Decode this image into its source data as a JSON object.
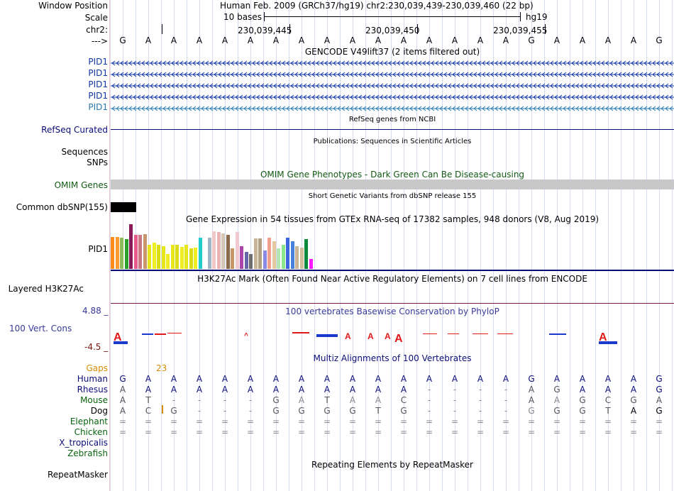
{
  "header": {
    "window_position_label": "Window Position",
    "scale_label": "Scale",
    "chrom_label": "chr2:",
    "strand_label": "--->",
    "assembly": "Human Feb. 2009 (GRCh37/hg19)   chr2:230,039,439-230,039,460 (22 bp)",
    "scale_text": "10 bases",
    "scale_db": "hg19",
    "positions": [
      "230,039,445",
      "230,039,450",
      "230,039,455"
    ]
  },
  "sequence": [
    "G",
    "A",
    "A",
    "A",
    "A",
    "A",
    "A",
    "A",
    "A",
    "A",
    "A",
    "A",
    "A",
    "A",
    "A",
    "A",
    "G",
    "A",
    "A",
    "A",
    "A",
    "G"
  ],
  "tracks": {
    "gencode_title": "GENCODE V49lift37 (2 items filtered out)",
    "gencode_items": [
      "PID1",
      "PID1",
      "PID1",
      "PID1",
      "PID1"
    ],
    "refseq_title": "RefSeq genes from NCBI",
    "refseq_label": "RefSeq Curated",
    "publications_title": "Publications: Sequences in Scientific Articles",
    "sequences_label": "Sequences",
    "snps_label": "SNPs",
    "omim_title": "OMIM Gene Phenotypes - Dark Green Can Be Disease-causing",
    "omim_label": "OMIM Genes",
    "dbsnp_title": "Short Genetic Variants from dbSNP release 155",
    "dbsnp_label": "Common dbSNP(155)",
    "gtex_title": "Gene Expression in 54 tissues from GTEx RNA-seq of 17382 samples, 948 donors (V8, Aug 2019)",
    "gtex_label": "PID1",
    "h3k27_title": "H3K27Ac Mark (Often Found Near Active Regulatory Elements) on 7 cell lines from ENCODE",
    "h3k27_label": "Layered H3K27Ac",
    "phylop_title": "100 vertebrates Basewise Conservation by PhyloP",
    "phylop_label": "100 Vert. Cons",
    "phylop_max": "4.88 _",
    "phylop_min": "-4.5 _",
    "multiz_title": "Multiz Alignments of 100 Vertebrates",
    "gaps_label": "Gaps",
    "gaps_value": "23",
    "repeat_title": "Repeating Elements by RepeatMasker",
    "repeat_label": "RepeatMasker"
  },
  "alignment": {
    "species": [
      "Human",
      "Rhesus",
      "Mouse",
      "Dog",
      "Elephant",
      "Chicken",
      "X_tropicalis",
      "Zebrafish"
    ],
    "rows": {
      "Human": [
        "G",
        "A",
        "A",
        "A",
        "A",
        "A",
        "A",
        "A",
        "A",
        "A",
        "A",
        "A",
        "A",
        "A",
        "A",
        "A",
        "G",
        "A",
        "A",
        "A",
        "A",
        "G"
      ],
      "Rhesus": [
        "A",
        "A",
        "A",
        "A",
        "A",
        "A",
        "A",
        "A",
        "A",
        "A",
        "A",
        "A",
        "-",
        "-",
        "-",
        "-",
        "A",
        "G",
        "A",
        "A",
        "A",
        "G"
      ],
      "Mouse": [
        "A",
        "T",
        "-",
        "-",
        "-",
        "-",
        "G",
        "A",
        "T",
        "A",
        "A",
        "C",
        "-",
        "-",
        "-",
        "-",
        "A",
        "A",
        "G",
        "C",
        "G",
        "A"
      ],
      "Dog": [
        "A",
        "C",
        "G",
        "-",
        "-",
        "-",
        "G",
        "G",
        "G",
        "G",
        "T",
        "G",
        "-",
        "-",
        "-",
        "-",
        "G",
        "G",
        "G",
        "T",
        "A",
        "G"
      ],
      "Elephant": [
        "=",
        "=",
        "=",
        "=",
        "=",
        "=",
        "=",
        "=",
        "=",
        "=",
        "=",
        "=",
        "=",
        "=",
        "=",
        "=",
        "=",
        "=",
        "=",
        "=",
        "=",
        "="
      ],
      "Chicken": [
        "=",
        "=",
        "=",
        "=",
        "=",
        "=",
        "=",
        "=",
        "=",
        "=",
        "=",
        "=",
        "=",
        "=",
        "=",
        "=",
        "=",
        "=",
        "=",
        "=",
        "=",
        "="
      ]
    }
  },
  "gtex_bars": [
    {
      "value": 0.95,
      "color": "#ff8c1a"
    },
    {
      "value": 0.95,
      "color": "#ff9b2e"
    },
    {
      "value": 0.92,
      "color": "#8fbc5a"
    },
    {
      "value": 0.88,
      "color": "#2ba02b"
    },
    {
      "value": 1.32,
      "color": "#8a1a5a"
    },
    {
      "value": 1.0,
      "color": "#e65a8c"
    },
    {
      "value": 1.0,
      "color": "#c87882"
    },
    {
      "value": 1.02,
      "color": "#c8966e"
    },
    {
      "value": 0.72,
      "color": "#e6e61a"
    },
    {
      "value": 0.78,
      "color": "#eeee22"
    },
    {
      "value": 0.72,
      "color": "#dcdc14"
    },
    {
      "value": 0.66,
      "color": "#e6e61a"
    },
    {
      "value": 0.45,
      "color": "#eeee22"
    },
    {
      "value": 0.72,
      "color": "#e6e61a"
    },
    {
      "value": 0.72,
      "color": "#dcdc14"
    },
    {
      "value": 0.65,
      "color": "#eeee22"
    },
    {
      "value": 0.72,
      "color": "#e6e61a"
    },
    {
      "value": 0.6,
      "color": "#dcdc14"
    },
    {
      "value": 0.62,
      "color": "#eeee22"
    },
    {
      "value": 0.92,
      "color": "#22cccc"
    },
    {
      "value": 0.0,
      "color": "#ffffff"
    },
    {
      "value": 0.92,
      "color": "#a0b4c8"
    },
    {
      "value": 1.1,
      "color": "#f0c8c8"
    },
    {
      "value": 1.08,
      "color": "#e8b4b4"
    },
    {
      "value": 1.04,
      "color": "#d4c8b4"
    },
    {
      "value": 1.0,
      "color": "#8a6a4a"
    },
    {
      "value": 0.6,
      "color": "#c89664"
    },
    {
      "value": 1.08,
      "color": "#f0c8d0"
    },
    {
      "value": 0.66,
      "color": "#aa44aa"
    },
    {
      "value": 0.5,
      "color": "#6666aa"
    },
    {
      "value": 0.45,
      "color": "#6e6e6e"
    },
    {
      "value": 0.91,
      "color": "#c8b496"
    },
    {
      "value": 0.91,
      "color": "#b4a082"
    },
    {
      "value": 0.55,
      "color": "#8a8ae6"
    },
    {
      "value": 0.92,
      "color": "#f0a08c"
    },
    {
      "value": 0.82,
      "color": "#e6c8a0"
    },
    {
      "value": 0.6,
      "color": "#b4e6b4"
    },
    {
      "value": 0.72,
      "color": "#8ce68c"
    },
    {
      "value": 0.92,
      "color": "#3c64dc"
    },
    {
      "value": 0.82,
      "color": "#4682dc"
    },
    {
      "value": 0.68,
      "color": "#c8b496"
    },
    {
      "value": 0.62,
      "color": "#d2be9b"
    },
    {
      "value": 0.88,
      "color": "#0a8a3c"
    },
    {
      "value": 0.3,
      "color": "#ff1aff"
    }
  ],
  "colors": {
    "navy": "#0c0c78",
    "gencode": "#1338a8",
    "gencode_last": "#2a7ab0",
    "omim_bar": "#c8c8c8",
    "dbsnp": "#000000",
    "h3k27": "#7a1a4a"
  },
  "icons": {
    "strand_arrows": "chevron-left-icon"
  }
}
